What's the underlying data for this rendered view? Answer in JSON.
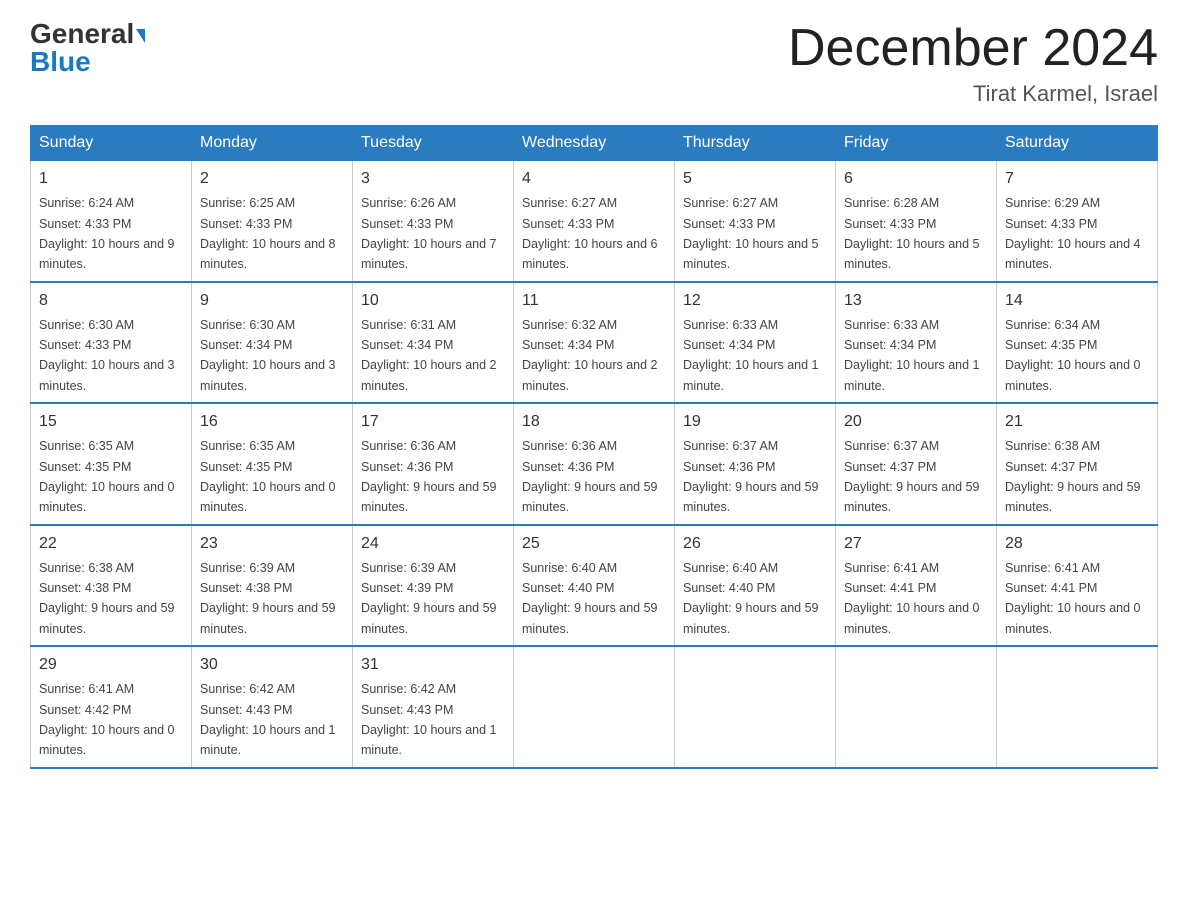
{
  "logo": {
    "text1": "General",
    "text2": "Blue"
  },
  "header": {
    "month": "December 2024",
    "location": "Tirat Karmel, Israel"
  },
  "weekdays": [
    "Sunday",
    "Monday",
    "Tuesday",
    "Wednesday",
    "Thursday",
    "Friday",
    "Saturday"
  ],
  "weeks": [
    [
      {
        "day": "1",
        "sunrise": "6:24 AM",
        "sunset": "4:33 PM",
        "daylight": "10 hours and 9 minutes."
      },
      {
        "day": "2",
        "sunrise": "6:25 AM",
        "sunset": "4:33 PM",
        "daylight": "10 hours and 8 minutes."
      },
      {
        "day": "3",
        "sunrise": "6:26 AM",
        "sunset": "4:33 PM",
        "daylight": "10 hours and 7 minutes."
      },
      {
        "day": "4",
        "sunrise": "6:27 AM",
        "sunset": "4:33 PM",
        "daylight": "10 hours and 6 minutes."
      },
      {
        "day": "5",
        "sunrise": "6:27 AM",
        "sunset": "4:33 PM",
        "daylight": "10 hours and 5 minutes."
      },
      {
        "day": "6",
        "sunrise": "6:28 AM",
        "sunset": "4:33 PM",
        "daylight": "10 hours and 5 minutes."
      },
      {
        "day": "7",
        "sunrise": "6:29 AM",
        "sunset": "4:33 PM",
        "daylight": "10 hours and 4 minutes."
      }
    ],
    [
      {
        "day": "8",
        "sunrise": "6:30 AM",
        "sunset": "4:33 PM",
        "daylight": "10 hours and 3 minutes."
      },
      {
        "day": "9",
        "sunrise": "6:30 AM",
        "sunset": "4:34 PM",
        "daylight": "10 hours and 3 minutes."
      },
      {
        "day": "10",
        "sunrise": "6:31 AM",
        "sunset": "4:34 PM",
        "daylight": "10 hours and 2 minutes."
      },
      {
        "day": "11",
        "sunrise": "6:32 AM",
        "sunset": "4:34 PM",
        "daylight": "10 hours and 2 minutes."
      },
      {
        "day": "12",
        "sunrise": "6:33 AM",
        "sunset": "4:34 PM",
        "daylight": "10 hours and 1 minute."
      },
      {
        "day": "13",
        "sunrise": "6:33 AM",
        "sunset": "4:34 PM",
        "daylight": "10 hours and 1 minute."
      },
      {
        "day": "14",
        "sunrise": "6:34 AM",
        "sunset": "4:35 PM",
        "daylight": "10 hours and 0 minutes."
      }
    ],
    [
      {
        "day": "15",
        "sunrise": "6:35 AM",
        "sunset": "4:35 PM",
        "daylight": "10 hours and 0 minutes."
      },
      {
        "day": "16",
        "sunrise": "6:35 AM",
        "sunset": "4:35 PM",
        "daylight": "10 hours and 0 minutes."
      },
      {
        "day": "17",
        "sunrise": "6:36 AM",
        "sunset": "4:36 PM",
        "daylight": "9 hours and 59 minutes."
      },
      {
        "day": "18",
        "sunrise": "6:36 AM",
        "sunset": "4:36 PM",
        "daylight": "9 hours and 59 minutes."
      },
      {
        "day": "19",
        "sunrise": "6:37 AM",
        "sunset": "4:36 PM",
        "daylight": "9 hours and 59 minutes."
      },
      {
        "day": "20",
        "sunrise": "6:37 AM",
        "sunset": "4:37 PM",
        "daylight": "9 hours and 59 minutes."
      },
      {
        "day": "21",
        "sunrise": "6:38 AM",
        "sunset": "4:37 PM",
        "daylight": "9 hours and 59 minutes."
      }
    ],
    [
      {
        "day": "22",
        "sunrise": "6:38 AM",
        "sunset": "4:38 PM",
        "daylight": "9 hours and 59 minutes."
      },
      {
        "day": "23",
        "sunrise": "6:39 AM",
        "sunset": "4:38 PM",
        "daylight": "9 hours and 59 minutes."
      },
      {
        "day": "24",
        "sunrise": "6:39 AM",
        "sunset": "4:39 PM",
        "daylight": "9 hours and 59 minutes."
      },
      {
        "day": "25",
        "sunrise": "6:40 AM",
        "sunset": "4:40 PM",
        "daylight": "9 hours and 59 minutes."
      },
      {
        "day": "26",
        "sunrise": "6:40 AM",
        "sunset": "4:40 PM",
        "daylight": "9 hours and 59 minutes."
      },
      {
        "day": "27",
        "sunrise": "6:41 AM",
        "sunset": "4:41 PM",
        "daylight": "10 hours and 0 minutes."
      },
      {
        "day": "28",
        "sunrise": "6:41 AM",
        "sunset": "4:41 PM",
        "daylight": "10 hours and 0 minutes."
      }
    ],
    [
      {
        "day": "29",
        "sunrise": "6:41 AM",
        "sunset": "4:42 PM",
        "daylight": "10 hours and 0 minutes."
      },
      {
        "day": "30",
        "sunrise": "6:42 AM",
        "sunset": "4:43 PM",
        "daylight": "10 hours and 1 minute."
      },
      {
        "day": "31",
        "sunrise": "6:42 AM",
        "sunset": "4:43 PM",
        "daylight": "10 hours and 1 minute."
      },
      null,
      null,
      null,
      null
    ]
  ],
  "labels": {
    "sunrise": "Sunrise:",
    "sunset": "Sunset:",
    "daylight": "Daylight:"
  }
}
